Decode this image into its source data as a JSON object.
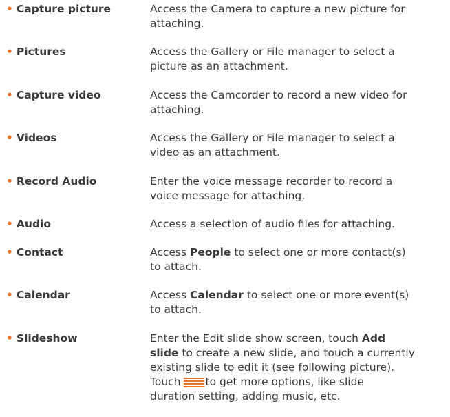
{
  "bullet": "•",
  "items": [
    {
      "term": "Capture picture",
      "lines": [
        "Access the Camera to capture a new picture for",
        "attaching."
      ]
    },
    {
      "term": "Pictures",
      "lines": [
        "Access the Gallery or File manager to select a",
        "picture as an attachment."
      ]
    },
    {
      "term": "Capture video",
      "lines": [
        "Access the Camcorder to record a new video for",
        "attaching."
      ]
    },
    {
      "term": "Videos",
      "lines": [
        "Access the Gallery or File manager to select a",
        "video as an attachment."
      ]
    },
    {
      "term": "Record Audio",
      "lines": [
        "Enter the voice message recorder to record a",
        "voice message for attaching."
      ]
    },
    {
      "term": "Audio",
      "lines": [
        "Access a selection of audio files for attaching."
      ]
    },
    {
      "term": "Contact",
      "line1_pre": "Access ",
      "line1_bold": "People",
      "line1_post": " to select one or more contact(s)",
      "line2": "to attach."
    },
    {
      "term": "Calendar",
      "line1_pre": "Access ",
      "line1_bold": "Calendar",
      "line1_post": " to select one or more event(s)",
      "line2": "to attach."
    },
    {
      "term": "Slideshow",
      "line1_pre": "Enter the Edit slide show screen, touch ",
      "line1_bold": "Add",
      "line2_bold": "slide",
      "line2_post": " to create a new slide, and touch a currently",
      "line3": "existing slide to edit it (see following picture).",
      "line4_pre": "Touch",
      "line4_post": "to get more options, like slide",
      "line5": "duration setting, adding music, etc.",
      "icon": "menu-icon"
    }
  ],
  "colors": {
    "bullet": "#e8732a",
    "text": "#3a3a3a",
    "icon": "#e8732a"
  }
}
